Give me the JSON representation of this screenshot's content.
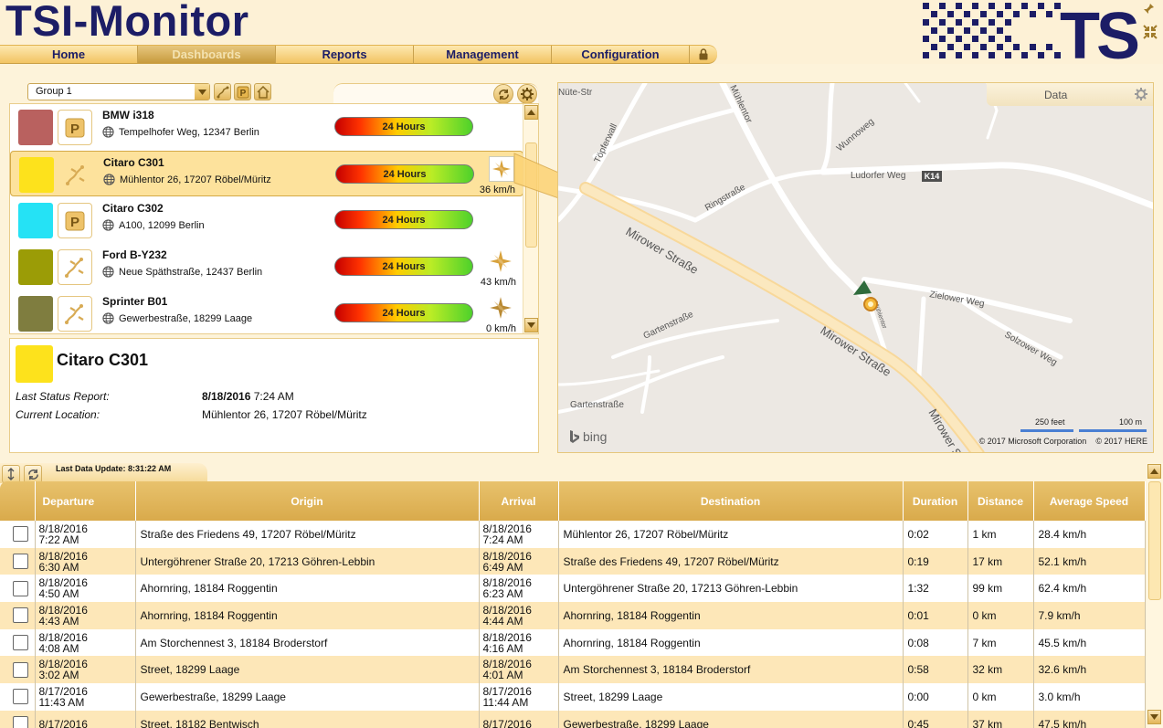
{
  "app": {
    "title": "TSI-Monitor"
  },
  "nav": {
    "items": [
      {
        "label": "Home",
        "active": false
      },
      {
        "label": "Dashboards",
        "active": true
      },
      {
        "label": "Reports",
        "active": false
      },
      {
        "label": "Management",
        "active": false
      },
      {
        "label": "Configuration",
        "active": false
      }
    ]
  },
  "group_select": {
    "value": "Group 1"
  },
  "vehicles": [
    {
      "name": "BMW i318",
      "address": "Tempelhofer Weg, 12347 Berlin",
      "color": "#b9615f",
      "status_icon": "parking-icon",
      "bar_label": "24 Hours",
      "speed": "",
      "selected": false
    },
    {
      "name": "Citaro C301",
      "address": "Mühlentor 26, 17207 Röbel/Müritz",
      "color": "#fde21c",
      "status_icon": "driving-icon",
      "bar_label": "24 Hours",
      "speed": "36 km/h",
      "selected": true
    },
    {
      "name": "Citaro C302",
      "address": "A100, 12099 Berlin",
      "color": "#25e2f5",
      "status_icon": "parking-icon",
      "bar_label": "24 Hours",
      "speed": "",
      "selected": false
    },
    {
      "name": "Ford B-Y232",
      "address": "Neue Späthstraße, 12437 Berlin",
      "color": "#9b9c06",
      "status_icon": "driving-icon",
      "bar_label": "24 Hours",
      "speed": "43 km/h",
      "selected": false
    },
    {
      "name": "Sprinter B01",
      "address": "Gewerbestraße, 18299 Laage",
      "color": "#7f7d3f",
      "status_icon": "driving-icon",
      "bar_label": "24 Hours",
      "speed": "0 km/h",
      "selected": false
    }
  ],
  "detail": {
    "name": "Citaro C301",
    "color": "#fde21c",
    "last_status_label": "Last Status Report:",
    "last_status_date": "8/18/2016",
    "last_status_time": "7:24 AM",
    "location_label": "Current Location:",
    "location_value": "Mühlentor 26, 17207 Röbel/Müritz"
  },
  "map": {
    "data_tab_label": "Data",
    "streets": {
      "muehlentor": "Mühlentor",
      "nuete": "Nüte-Str",
      "toepferwall": "Töpferwall",
      "wunnoweg": "Wunnoweg",
      "ludorfer": "Ludorfer Weg",
      "k14": "K14",
      "ringstrasse": "Ringstraße",
      "mirower1": "Mirower Straße",
      "mirower2": "Mirower Straße",
      "mirower3": "Mirower Straße",
      "zielower": "Zielower Weg",
      "solzower": "Solzower Weg",
      "gartenstrasse1": "Gartenstraße",
      "gartenstrasse2": "Gartenstraße",
      "muehlentor2": "Mühlentor"
    },
    "bing_label": "bing",
    "scale_feet": "250 feet",
    "scale_m": "100 m",
    "copyright_ms": "© 2017 Microsoft Corporation",
    "copyright_here": "© 2017 HERE"
  },
  "trips": {
    "last_update": "Last Data Update: 8:31:22 AM",
    "columns": [
      "",
      "Departure",
      "Origin",
      "Arrival",
      "Destination",
      "Duration",
      "Distance",
      "Average Speed"
    ],
    "rows": [
      {
        "dep_date": "8/18/2016",
        "dep_time": "7:22 AM",
        "origin": "Straße des Friedens 49, 17207 Röbel/Müritz",
        "arr_date": "8/18/2016",
        "arr_time": "7:24 AM",
        "destination": "Mühlentor 26, 17207 Röbel/Müritz",
        "duration": "0:02",
        "distance": "1 km",
        "speed": "28.4 km/h"
      },
      {
        "dep_date": "8/18/2016",
        "dep_time": "6:30 AM",
        "origin": "Untergöhrener Straße 20, 17213 Göhren-Lebbin",
        "arr_date": "8/18/2016",
        "arr_time": "6:49 AM",
        "destination": "Straße des Friedens 49, 17207 Röbel/Müritz",
        "duration": "0:19",
        "distance": "17 km",
        "speed": "52.1 km/h"
      },
      {
        "dep_date": "8/18/2016",
        "dep_time": "4:50 AM",
        "origin": "Ahornring, 18184 Roggentin",
        "arr_date": "8/18/2016",
        "arr_time": "6:23 AM",
        "destination": "Untergöhrener Straße 20, 17213 Göhren-Lebbin",
        "duration": "1:32",
        "distance": "99 km",
        "speed": "62.4 km/h"
      },
      {
        "dep_date": "8/18/2016",
        "dep_time": "4:43 AM",
        "origin": "Ahornring, 18184 Roggentin",
        "arr_date": "8/18/2016",
        "arr_time": "4:44 AM",
        "destination": "Ahornring, 18184 Roggentin",
        "duration": "0:01",
        "distance": "0 km",
        "speed": "7.9 km/h"
      },
      {
        "dep_date": "8/18/2016",
        "dep_time": "4:08 AM",
        "origin": "Am Storchennest 3, 18184 Broderstorf",
        "arr_date": "8/18/2016",
        "arr_time": "4:16 AM",
        "destination": "Ahornring, 18184 Roggentin",
        "duration": "0:08",
        "distance": "7 km",
        "speed": "45.5 km/h"
      },
      {
        "dep_date": "8/18/2016",
        "dep_time": "3:02 AM",
        "origin": "Street, 18299 Laage",
        "arr_date": "8/18/2016",
        "arr_time": "4:01 AM",
        "destination": "Am Storchennest 3, 18184 Broderstorf",
        "duration": "0:58",
        "distance": "32 km",
        "speed": "32.6 km/h"
      },
      {
        "dep_date": "8/17/2016",
        "dep_time": "11:43 AM",
        "origin": "Gewerbestraße, 18299 Laage",
        "arr_date": "8/17/2016",
        "arr_time": "11:44 AM",
        "destination": "Street, 18299 Laage",
        "duration": "0:00",
        "distance": "0 km",
        "speed": "3.0 km/h"
      },
      {
        "dep_date": "8/17/2016",
        "dep_time": "",
        "origin": "Street, 18182 Bentwisch",
        "arr_date": "8/17/2016",
        "arr_time": "",
        "destination": "Gewerbestraße, 18299 Laage",
        "duration": "0:45",
        "distance": "37 km",
        "speed": "47.5 km/h"
      }
    ]
  }
}
